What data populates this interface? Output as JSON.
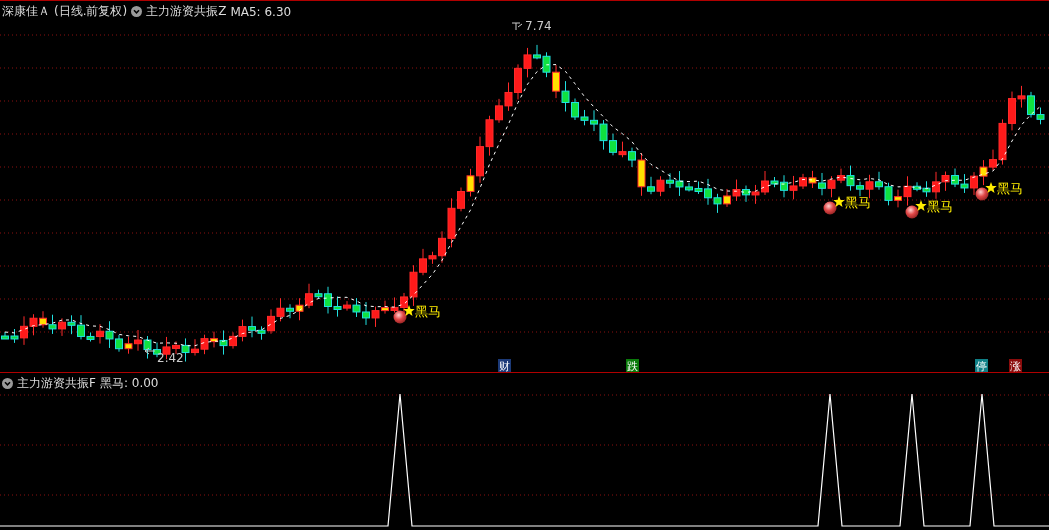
{
  "main_panel": {
    "stock_name": "深康佳Ａ",
    "period": "(日线.前复权)",
    "indicator": "主力游资共振Z",
    "ma_label": "MA5: 6.30",
    "high_label": "7.74",
    "low_label": "2.42",
    "signals": [
      {
        "label": "黑马"
      },
      {
        "label": "黑马"
      },
      {
        "label": "黑马"
      },
      {
        "label": "黑马"
      }
    ],
    "events": [
      {
        "label": "财",
        "color": "#1c3a78"
      },
      {
        "label": "跌",
        "color": "#0a7a0a"
      },
      {
        "label": "停",
        "color": "#0f7f86"
      },
      {
        "label": "涨",
        "color": "#8a0c0c"
      }
    ]
  },
  "sub_panel": {
    "indicator": "主力游资共振F",
    "value_label": "黑马: 0.00"
  }
}
